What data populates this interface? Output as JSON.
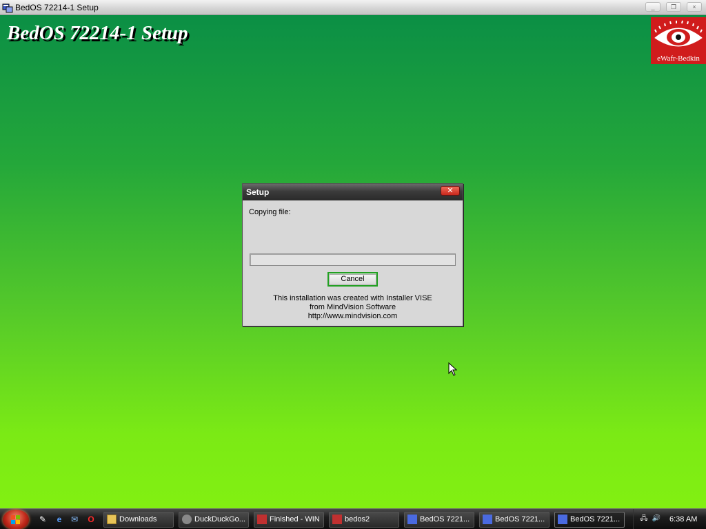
{
  "window": {
    "title": "BedOS 72214-1 Setup",
    "minimize_glyph": "_",
    "restore_glyph": "❐",
    "close_glyph": "×"
  },
  "setup": {
    "heading": "BedOS 72214-1 Setup",
    "logo_text": "eWafr-Bedkin"
  },
  "dialog": {
    "title": "Setup",
    "close_glyph": "✕",
    "copying_label": "Copying file:",
    "progress_fraction": 0,
    "cancel_label": "Cancel",
    "credits_line1": "This installation was created with Installer VISE",
    "credits_line2": "from MindVision Software",
    "credits_line3": "http://www.mindvision.com"
  },
  "taskbar": {
    "quick_launch": [
      {
        "icon": "show-desktop-icon",
        "glyph": "✎"
      },
      {
        "icon": "internet-explorer-icon",
        "glyph": "e"
      },
      {
        "icon": "switch-windows-icon",
        "glyph": "✉"
      },
      {
        "icon": "opera-icon",
        "glyph": "O"
      }
    ],
    "buttons": [
      {
        "label": "Downloads",
        "icon": "folder-icon"
      },
      {
        "label": "DuckDuckGo...",
        "icon": "duckduckgo-icon"
      },
      {
        "label": "Finished - WIN",
        "icon": "vise-icon"
      },
      {
        "label": "bedos2",
        "icon": "vise-icon"
      },
      {
        "label": "BedOS 7221...",
        "icon": "setup-icon"
      },
      {
        "label": "BedOS 7221...",
        "icon": "setup-icon"
      },
      {
        "label": "BedOS 7221...",
        "icon": "setup-icon"
      }
    ],
    "clock": "6:38 AM"
  },
  "colors": {
    "gradient_top": "#0b8f45",
    "gradient_bottom": "#82f012",
    "logo_red": "#d01c1c",
    "cancel_focus": "#22a022"
  }
}
